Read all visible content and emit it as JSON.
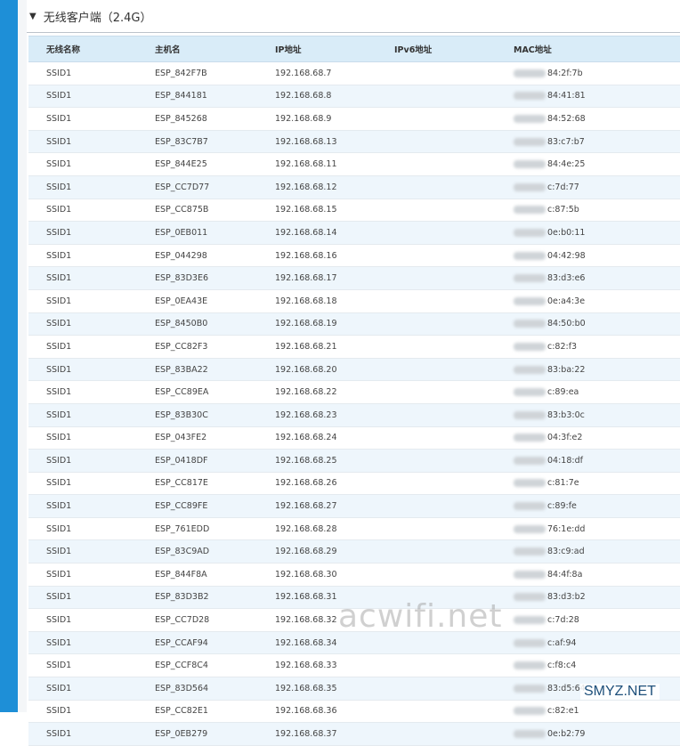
{
  "section": {
    "title": "无线客户端（2.4G）",
    "icon": "triangle-down-icon"
  },
  "columns": [
    "无线名称",
    "主机名",
    "IP地址",
    "IPv6地址",
    "MAC地址"
  ],
  "rows": [
    {
      "ssid": "SSID1",
      "host": "ESP_842F7B",
      "ip": "192.168.68.7",
      "ipv6": "",
      "mac": "84:2f:7b"
    },
    {
      "ssid": "SSID1",
      "host": "ESP_844181",
      "ip": "192.168.68.8",
      "ipv6": "",
      "mac": "84:41:81"
    },
    {
      "ssid": "SSID1",
      "host": "ESP_845268",
      "ip": "192.168.68.9",
      "ipv6": "",
      "mac": "84:52:68"
    },
    {
      "ssid": "SSID1",
      "host": "ESP_83C7B7",
      "ip": "192.168.68.13",
      "ipv6": "",
      "mac": "83:c7:b7"
    },
    {
      "ssid": "SSID1",
      "host": "ESP_844E25",
      "ip": "192.168.68.11",
      "ipv6": "",
      "mac": "84:4e:25"
    },
    {
      "ssid": "SSID1",
      "host": "ESP_CC7D77",
      "ip": "192.168.68.12",
      "ipv6": "",
      "mac": "c:7d:77"
    },
    {
      "ssid": "SSID1",
      "host": "ESP_CC875B",
      "ip": "192.168.68.15",
      "ipv6": "",
      "mac": "c:87:5b"
    },
    {
      "ssid": "SSID1",
      "host": "ESP_0EB011",
      "ip": "192.168.68.14",
      "ipv6": "",
      "mac": "0e:b0:11"
    },
    {
      "ssid": "SSID1",
      "host": "ESP_044298",
      "ip": "192.168.68.16",
      "ipv6": "",
      "mac": "04:42:98"
    },
    {
      "ssid": "SSID1",
      "host": "ESP_83D3E6",
      "ip": "192.168.68.17",
      "ipv6": "",
      "mac": "83:d3:e6"
    },
    {
      "ssid": "SSID1",
      "host": "ESP_0EA43E",
      "ip": "192.168.68.18",
      "ipv6": "",
      "mac": "0e:a4:3e"
    },
    {
      "ssid": "SSID1",
      "host": "ESP_8450B0",
      "ip": "192.168.68.19",
      "ipv6": "",
      "mac": "84:50:b0"
    },
    {
      "ssid": "SSID1",
      "host": "ESP_CC82F3",
      "ip": "192.168.68.21",
      "ipv6": "",
      "mac": "c:82:f3"
    },
    {
      "ssid": "SSID1",
      "host": "ESP_83BA22",
      "ip": "192.168.68.20",
      "ipv6": "",
      "mac": "83:ba:22"
    },
    {
      "ssid": "SSID1",
      "host": "ESP_CC89EA",
      "ip": "192.168.68.22",
      "ipv6": "",
      "mac": "c:89:ea"
    },
    {
      "ssid": "SSID1",
      "host": "ESP_83B30C",
      "ip": "192.168.68.23",
      "ipv6": "",
      "mac": "83:b3:0c"
    },
    {
      "ssid": "SSID1",
      "host": "ESP_043FE2",
      "ip": "192.168.68.24",
      "ipv6": "",
      "mac": "04:3f:e2"
    },
    {
      "ssid": "SSID1",
      "host": "ESP_0418DF",
      "ip": "192.168.68.25",
      "ipv6": "",
      "mac": "04:18:df"
    },
    {
      "ssid": "SSID1",
      "host": "ESP_CC817E",
      "ip": "192.168.68.26",
      "ipv6": "",
      "mac": "c:81:7e"
    },
    {
      "ssid": "SSID1",
      "host": "ESP_CC89FE",
      "ip": "192.168.68.27",
      "ipv6": "",
      "mac": "c:89:fe"
    },
    {
      "ssid": "SSID1",
      "host": "ESP_761EDD",
      "ip": "192.168.68.28",
      "ipv6": "",
      "mac": "76:1e:dd"
    },
    {
      "ssid": "SSID1",
      "host": "ESP_83C9AD",
      "ip": "192.168.68.29",
      "ipv6": "",
      "mac": "83:c9:ad"
    },
    {
      "ssid": "SSID1",
      "host": "ESP_844F8A",
      "ip": "192.168.68.30",
      "ipv6": "",
      "mac": "84:4f:8a"
    },
    {
      "ssid": "SSID1",
      "host": "ESP_83D3B2",
      "ip": "192.168.68.31",
      "ipv6": "",
      "mac": "83:d3:b2"
    },
    {
      "ssid": "SSID1",
      "host": "ESP_CC7D28",
      "ip": "192.168.68.32",
      "ipv6": "",
      "mac": "c:7d:28"
    },
    {
      "ssid": "SSID1",
      "host": "ESP_CCAF94",
      "ip": "192.168.68.34",
      "ipv6": "",
      "mac": "c:af:94"
    },
    {
      "ssid": "SSID1",
      "host": "ESP_CCF8C4",
      "ip": "192.168.68.33",
      "ipv6": "",
      "mac": "c:f8:c4"
    },
    {
      "ssid": "SSID1",
      "host": "ESP_83D564",
      "ip": "192.168.68.35",
      "ipv6": "",
      "mac": "83:d5:64"
    },
    {
      "ssid": "SSID1",
      "host": "ESP_CC82E1",
      "ip": "192.168.68.36",
      "ipv6": "",
      "mac": "c:82:e1"
    },
    {
      "ssid": "SSID1",
      "host": "ESP_0EB279",
      "ip": "192.168.68.37",
      "ipv6": "",
      "mac": "0e:b2:79"
    }
  ],
  "watermarks": {
    "center": "acwifi.net",
    "corner": "SMYZ.NET"
  },
  "colors": {
    "sidebar": "#1e8fd7",
    "header_bg": "#d9ecf8",
    "row_alt": "#eef6fc"
  }
}
